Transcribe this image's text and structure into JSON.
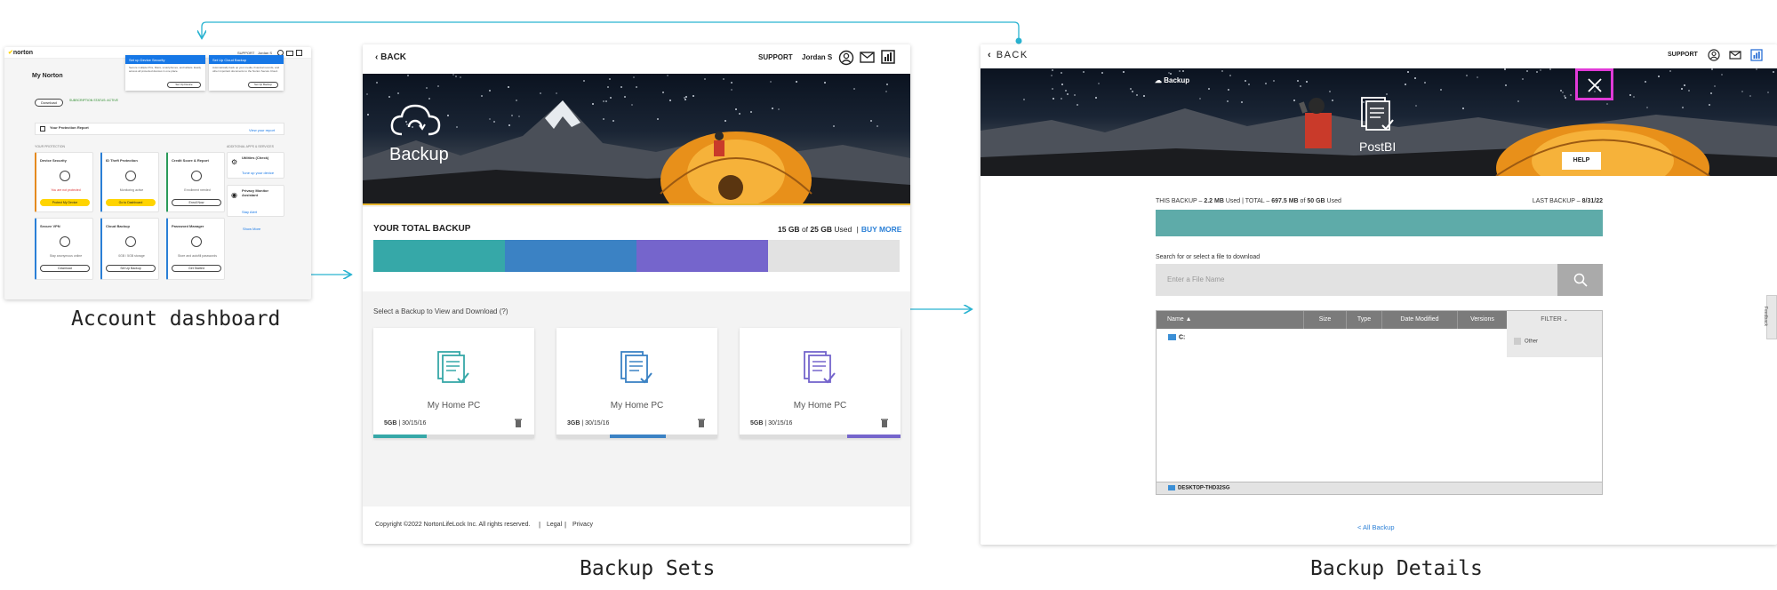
{
  "captions": {
    "dashboard": "Account dashboard",
    "sets": "Backup Sets",
    "details": "Backup Details"
  },
  "colors": {
    "arrow": "#29b3d1",
    "teal": "#36a8a8",
    "blue": "#3b82c4",
    "purple": "#7565cc",
    "highlight": "#e13ad8",
    "yellow": "#ffd400"
  },
  "dashboard": {
    "logo": "norton",
    "support": "SUPPORT",
    "user": "Jordan S",
    "title": "My Norton",
    "download_btn": "Download",
    "subscription": "SUBSCRIPTION STATUS: ACTIVE",
    "popup1_title": "Set up Device Security",
    "popup1_text": "Secure multiple PCs, Macs, smartphones, and tablets. Easily access all protected devices in one place.",
    "popup1_btn": "Set Up Device",
    "popup2_title": "Set Up Cloud Backup",
    "popup2_text": "Automatically back up your media, financial records, and other important documents to the Norton Secure Cloud.",
    "popup2_btn": "Set Up Backup",
    "report_title": "Your Protection Report",
    "report_link": "View your report",
    "your_protection": "YOUR PROTECTION",
    "additional": "ADDITIONAL APPS & SERVICES",
    "tiles": [
      {
        "title": "Device Security",
        "status": "You are not protected",
        "btn": "Protect My Device"
      },
      {
        "title": "ID Theft Protection",
        "status": "Monitoring active",
        "btn": "Go to Dashboard"
      },
      {
        "title": "Credit Score & Report",
        "status": "Enrollment needed",
        "btn": "Enroll Now"
      },
      {
        "title": "Secure VPN",
        "status": "Stay anonymous online",
        "btn": "Download"
      },
      {
        "title": "Cloud Backup",
        "status": "0GB / 5GB storage",
        "btn": "Set Up Backup"
      },
      {
        "title": "Password Manager",
        "status": "Store and autofill passwords",
        "btn": "Get Started"
      }
    ],
    "side_tiles": [
      {
        "title": "Utilities (Check)",
        "link": "Tune up your device"
      },
      {
        "title": "Privacy Monitor Assistant",
        "link": "Stay Alert"
      }
    ],
    "show_more": "Show More"
  },
  "sets": {
    "back": "BACK",
    "support": "SUPPORT",
    "user": "Jordan S",
    "hero_title": "Backup",
    "total_label": "YOUR TOTAL BACKUP",
    "used_amount": "15 GB",
    "of_text": "of",
    "total_amount": "25 GB",
    "used_text": "Used",
    "buy_more": "BUY MORE",
    "usage": [
      {
        "color": "#36a8a8",
        "fraction": 0.25
      },
      {
        "color": "#3b82c4",
        "fraction": 0.25
      },
      {
        "color": "#7565cc",
        "fraction": 0.25
      }
    ],
    "select_prompt": "Select a Backup to View and Download (?)",
    "cards": [
      {
        "name": "My Home PC",
        "size": "5GB",
        "date": "30/15/16",
        "color": "#36a8a8",
        "fill_start": 0.0,
        "fill_end": 0.33
      },
      {
        "name": "My Home PC",
        "size": "3GB",
        "date": "30/15/16",
        "color": "#3b82c4",
        "fill_start": 0.33,
        "fill_end": 0.68
      },
      {
        "name": "My Home PC",
        "size": "5GB",
        "date": "30/15/16",
        "color": "#7565cc",
        "fill_start": 0.67,
        "fill_end": 1.0
      }
    ],
    "copyright": "Copyright ©2022 NortonLifeLock Inc. All rights reserved.",
    "legal": "Legal",
    "privacy": "Privacy"
  },
  "details": {
    "back": "BACK",
    "support": "SUPPORT",
    "hero_label": "Backup",
    "backup_name": "PostBI",
    "help": "HELP",
    "this_backup_label": "THIS BACKUP –",
    "this_backup_value": "2.2 MB",
    "this_used": "Used | TOTAL –",
    "total_used": "697.5 MB",
    "of_text": "of",
    "total_cap": "50 GB",
    "used_text": "Used",
    "last_backup_label": "LAST BACKUP –",
    "last_backup_date": "8/31/22",
    "search_label": "Search for or select a file to download",
    "search_placeholder": "Enter a File Name",
    "columns": [
      "Name ▲",
      "Size",
      "Type",
      "Date Modified",
      "Versions"
    ],
    "filter": "FILTER",
    "filter_option": "Other",
    "tree_root": "C:",
    "device": "DESKTOP-THD32SG",
    "all_backups": "< All Backup",
    "feedback": "Feedback"
  }
}
